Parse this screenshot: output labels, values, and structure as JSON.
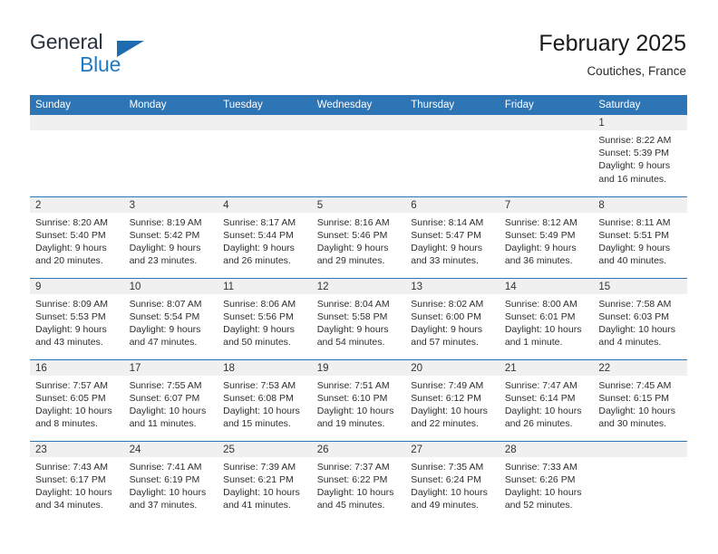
{
  "brand": {
    "name_part1": "General",
    "name_part2": "Blue"
  },
  "header": {
    "title": "February 2025",
    "subtitle": "Coutiches, France"
  },
  "colors": {
    "header_blue": "#2e75b6",
    "logo_blue": "#1f7ac4",
    "daynum_band": "#f0f0f0"
  },
  "weekdays": [
    "Sunday",
    "Monday",
    "Tuesday",
    "Wednesday",
    "Thursday",
    "Friday",
    "Saturday"
  ],
  "weeks": [
    [
      {
        "day": "",
        "empty": true
      },
      {
        "day": "",
        "empty": true
      },
      {
        "day": "",
        "empty": true
      },
      {
        "day": "",
        "empty": true
      },
      {
        "day": "",
        "empty": true
      },
      {
        "day": "",
        "empty": true
      },
      {
        "day": "1",
        "sunrise": "Sunrise: 8:22 AM",
        "sunset": "Sunset: 5:39 PM",
        "daylight1": "Daylight: 9 hours",
        "daylight2": "and 16 minutes."
      }
    ],
    [
      {
        "day": "2",
        "sunrise": "Sunrise: 8:20 AM",
        "sunset": "Sunset: 5:40 PM",
        "daylight1": "Daylight: 9 hours",
        "daylight2": "and 20 minutes."
      },
      {
        "day": "3",
        "sunrise": "Sunrise: 8:19 AM",
        "sunset": "Sunset: 5:42 PM",
        "daylight1": "Daylight: 9 hours",
        "daylight2": "and 23 minutes."
      },
      {
        "day": "4",
        "sunrise": "Sunrise: 8:17 AM",
        "sunset": "Sunset: 5:44 PM",
        "daylight1": "Daylight: 9 hours",
        "daylight2": "and 26 minutes."
      },
      {
        "day": "5",
        "sunrise": "Sunrise: 8:16 AM",
        "sunset": "Sunset: 5:46 PM",
        "daylight1": "Daylight: 9 hours",
        "daylight2": "and 29 minutes."
      },
      {
        "day": "6",
        "sunrise": "Sunrise: 8:14 AM",
        "sunset": "Sunset: 5:47 PM",
        "daylight1": "Daylight: 9 hours",
        "daylight2": "and 33 minutes."
      },
      {
        "day": "7",
        "sunrise": "Sunrise: 8:12 AM",
        "sunset": "Sunset: 5:49 PM",
        "daylight1": "Daylight: 9 hours",
        "daylight2": "and 36 minutes."
      },
      {
        "day": "8",
        "sunrise": "Sunrise: 8:11 AM",
        "sunset": "Sunset: 5:51 PM",
        "daylight1": "Daylight: 9 hours",
        "daylight2": "and 40 minutes."
      }
    ],
    [
      {
        "day": "9",
        "sunrise": "Sunrise: 8:09 AM",
        "sunset": "Sunset: 5:53 PM",
        "daylight1": "Daylight: 9 hours",
        "daylight2": "and 43 minutes."
      },
      {
        "day": "10",
        "sunrise": "Sunrise: 8:07 AM",
        "sunset": "Sunset: 5:54 PM",
        "daylight1": "Daylight: 9 hours",
        "daylight2": "and 47 minutes."
      },
      {
        "day": "11",
        "sunrise": "Sunrise: 8:06 AM",
        "sunset": "Sunset: 5:56 PM",
        "daylight1": "Daylight: 9 hours",
        "daylight2": "and 50 minutes."
      },
      {
        "day": "12",
        "sunrise": "Sunrise: 8:04 AM",
        "sunset": "Sunset: 5:58 PM",
        "daylight1": "Daylight: 9 hours",
        "daylight2": "and 54 minutes."
      },
      {
        "day": "13",
        "sunrise": "Sunrise: 8:02 AM",
        "sunset": "Sunset: 6:00 PM",
        "daylight1": "Daylight: 9 hours",
        "daylight2": "and 57 minutes."
      },
      {
        "day": "14",
        "sunrise": "Sunrise: 8:00 AM",
        "sunset": "Sunset: 6:01 PM",
        "daylight1": "Daylight: 10 hours",
        "daylight2": "and 1 minute."
      },
      {
        "day": "15",
        "sunrise": "Sunrise: 7:58 AM",
        "sunset": "Sunset: 6:03 PM",
        "daylight1": "Daylight: 10 hours",
        "daylight2": "and 4 minutes."
      }
    ],
    [
      {
        "day": "16",
        "sunrise": "Sunrise: 7:57 AM",
        "sunset": "Sunset: 6:05 PM",
        "daylight1": "Daylight: 10 hours",
        "daylight2": "and 8 minutes."
      },
      {
        "day": "17",
        "sunrise": "Sunrise: 7:55 AM",
        "sunset": "Sunset: 6:07 PM",
        "daylight1": "Daylight: 10 hours",
        "daylight2": "and 11 minutes."
      },
      {
        "day": "18",
        "sunrise": "Sunrise: 7:53 AM",
        "sunset": "Sunset: 6:08 PM",
        "daylight1": "Daylight: 10 hours",
        "daylight2": "and 15 minutes."
      },
      {
        "day": "19",
        "sunrise": "Sunrise: 7:51 AM",
        "sunset": "Sunset: 6:10 PM",
        "daylight1": "Daylight: 10 hours",
        "daylight2": "and 19 minutes."
      },
      {
        "day": "20",
        "sunrise": "Sunrise: 7:49 AM",
        "sunset": "Sunset: 6:12 PM",
        "daylight1": "Daylight: 10 hours",
        "daylight2": "and 22 minutes."
      },
      {
        "day": "21",
        "sunrise": "Sunrise: 7:47 AM",
        "sunset": "Sunset: 6:14 PM",
        "daylight1": "Daylight: 10 hours",
        "daylight2": "and 26 minutes."
      },
      {
        "day": "22",
        "sunrise": "Sunrise: 7:45 AM",
        "sunset": "Sunset: 6:15 PM",
        "daylight1": "Daylight: 10 hours",
        "daylight2": "and 30 minutes."
      }
    ],
    [
      {
        "day": "23",
        "sunrise": "Sunrise: 7:43 AM",
        "sunset": "Sunset: 6:17 PM",
        "daylight1": "Daylight: 10 hours",
        "daylight2": "and 34 minutes."
      },
      {
        "day": "24",
        "sunrise": "Sunrise: 7:41 AM",
        "sunset": "Sunset: 6:19 PM",
        "daylight1": "Daylight: 10 hours",
        "daylight2": "and 37 minutes."
      },
      {
        "day": "25",
        "sunrise": "Sunrise: 7:39 AM",
        "sunset": "Sunset: 6:21 PM",
        "daylight1": "Daylight: 10 hours",
        "daylight2": "and 41 minutes."
      },
      {
        "day": "26",
        "sunrise": "Sunrise: 7:37 AM",
        "sunset": "Sunset: 6:22 PM",
        "daylight1": "Daylight: 10 hours",
        "daylight2": "and 45 minutes."
      },
      {
        "day": "27",
        "sunrise": "Sunrise: 7:35 AM",
        "sunset": "Sunset: 6:24 PM",
        "daylight1": "Daylight: 10 hours",
        "daylight2": "and 49 minutes."
      },
      {
        "day": "28",
        "sunrise": "Sunrise: 7:33 AM",
        "sunset": "Sunset: 6:26 PM",
        "daylight1": "Daylight: 10 hours",
        "daylight2": "and 52 minutes."
      },
      {
        "day": "",
        "empty": true
      }
    ]
  ]
}
